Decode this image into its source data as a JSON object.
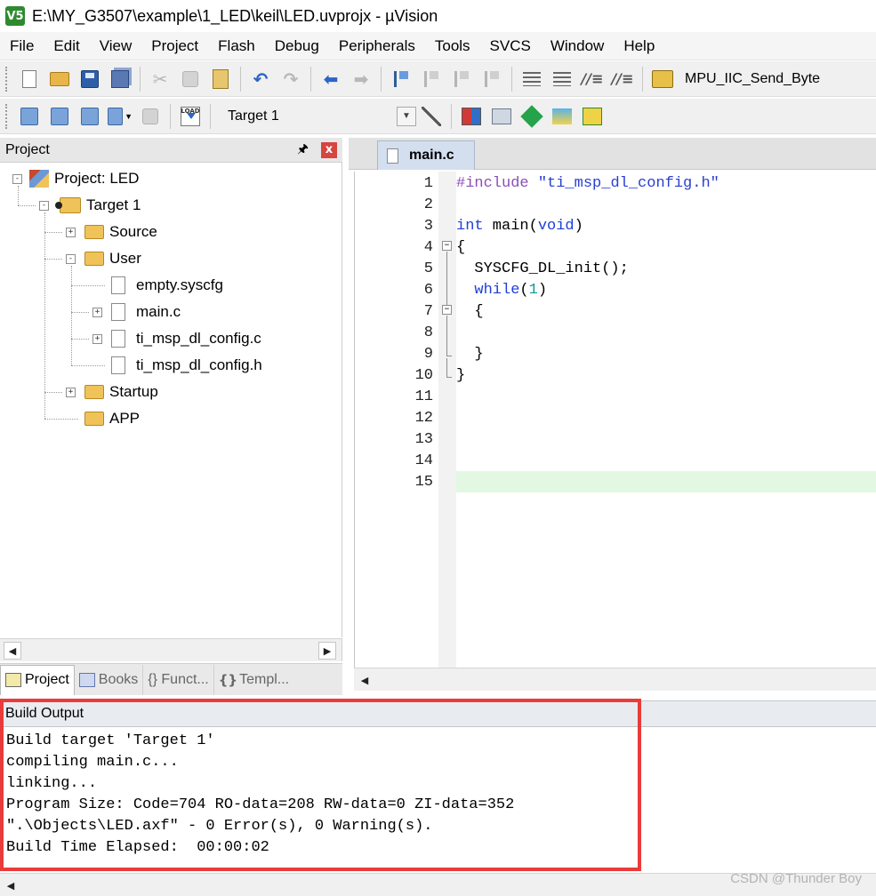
{
  "window": {
    "title": "E:\\MY_G3507\\example\\1_LED\\keil\\LED.uvprojx - µVision",
    "app_icon_text": "V5"
  },
  "menu": [
    "File",
    "Edit",
    "View",
    "Project",
    "Flash",
    "Debug",
    "Peripherals",
    "Tools",
    "SVCS",
    "Window",
    "Help"
  ],
  "toolbar": {
    "find_text": "MPU_IIC_Send_Byte",
    "load_label": "LOAD",
    "target_select": "Target 1"
  },
  "project_panel": {
    "title": "Project",
    "pin": "p",
    "close": "x",
    "tree": [
      {
        "label": "Project: LED",
        "expander": "-"
      },
      {
        "label": "Target 1",
        "expander": "-"
      },
      {
        "label": "Source",
        "expander": "+"
      },
      {
        "label": "User",
        "expander": "-"
      },
      {
        "label": "empty.syscfg",
        "expander": ""
      },
      {
        "label": "main.c",
        "expander": "+"
      },
      {
        "label": "ti_msp_dl_config.c",
        "expander": "+"
      },
      {
        "label": "ti_msp_dl_config.h",
        "expander": ""
      },
      {
        "label": "Startup",
        "expander": "+"
      },
      {
        "label": "APP",
        "expander": ""
      }
    ],
    "tabs": [
      "Project",
      "Books",
      "{} Funct...",
      "Templ..."
    ]
  },
  "editor": {
    "active_tab": "main.c",
    "line_numbers": [
      "1",
      "2",
      "3",
      "4",
      "5",
      "6",
      "7",
      "8",
      "9",
      "10",
      "11",
      "12",
      "13",
      "14",
      "15"
    ],
    "current_line": 15
  },
  "build_output": {
    "title": "Build Output",
    "lines": [
      "Build target 'Target 1'",
      "compiling main.c...",
      "linking...",
      "Program Size: Code=704 RO-data=208 RW-data=0 ZI-data=352",
      "\".\\Objects\\LED.axf\" - 0 Error(s), 0 Warning(s).",
      "Build Time Elapsed:  00:00:02"
    ]
  },
  "watermark": "CSDN @Thunder Boy",
  "colors": {
    "highlight_box": "#ea3b3b",
    "current_line": "#e3f8e3",
    "keyword": "#1f3fd6",
    "preprocessor": "#8a4fb8",
    "number": "#0a9a98"
  }
}
